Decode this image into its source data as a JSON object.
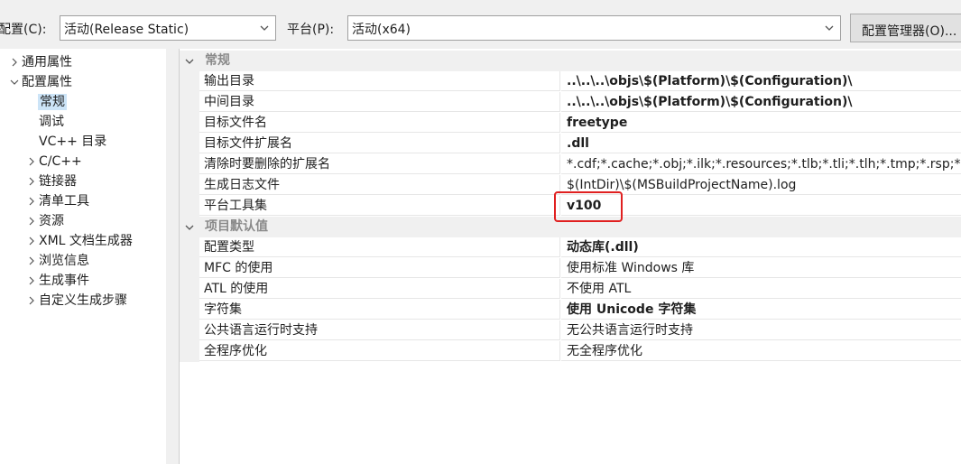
{
  "toolbar": {
    "config_label": "配置(C):",
    "config_value": "活动(Release Static)",
    "platform_label": "平台(P):",
    "platform_value": "活动(x64)",
    "manager_button": "配置管理器(O)..."
  },
  "tree": {
    "items": [
      {
        "label": "通用属性"
      },
      {
        "label": "配置属性"
      },
      {
        "label": "常规"
      },
      {
        "label": "调试"
      },
      {
        "label": "VC++ 目录"
      },
      {
        "label": "C/C++"
      },
      {
        "label": "链接器"
      },
      {
        "label": "清单工具"
      },
      {
        "label": "资源"
      },
      {
        "label": "XML 文档生成器"
      },
      {
        "label": "浏览信息"
      },
      {
        "label": "生成事件"
      },
      {
        "label": "自定义生成步骤"
      }
    ]
  },
  "grid": {
    "categories": [
      {
        "label": "常规"
      },
      {
        "label": "项目默认值"
      }
    ],
    "general": [
      {
        "name": "输出目录",
        "value": "..\\..\\..\\objs\\$(Platform)\\$(Configuration)\\"
      },
      {
        "name": "中间目录",
        "value": "..\\..\\..\\objs\\$(Platform)\\$(Configuration)\\"
      },
      {
        "name": "目标文件名",
        "value": "freetype"
      },
      {
        "name": "目标文件扩展名",
        "value": ".dll"
      },
      {
        "name": "清除时要删除的扩展名",
        "value": "*.cdf;*.cache;*.obj;*.ilk;*.resources;*.tlb;*.tli;*.tlh;*.tmp;*.rsp;*"
      },
      {
        "name": "生成日志文件",
        "value": "$(IntDir)\\$(MSBuildProjectName).log"
      },
      {
        "name": "平台工具集",
        "value": "v100"
      }
    ],
    "defaults": [
      {
        "name": "配置类型",
        "value": "动态库(.dll)"
      },
      {
        "name": "MFC 的使用",
        "value": "使用标准 Windows 库"
      },
      {
        "name": "ATL 的使用",
        "value": "不使用 ATL"
      },
      {
        "name": "字符集",
        "value": "使用 Unicode 字符集"
      },
      {
        "name": "公共语言运行时支持",
        "value": "无公共语言运行时支持"
      },
      {
        "name": "全程序优化",
        "value": "无全程序优化"
      }
    ]
  },
  "colors": {
    "selection": "#cce4f7",
    "highlight_box": "#e02020",
    "category_text": "#8a8a8a"
  }
}
